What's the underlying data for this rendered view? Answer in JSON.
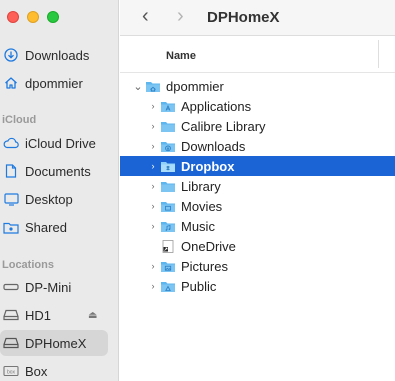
{
  "window": {
    "title": "DPHomeX"
  },
  "sidebar": {
    "favorites": [
      {
        "label": "Downloads",
        "icon": "download-circle-icon"
      },
      {
        "label": "dpommier",
        "icon": "home-icon"
      }
    ],
    "icloud_heading": "iCloud",
    "icloud": [
      {
        "label": "iCloud Drive",
        "icon": "cloud-icon"
      },
      {
        "label": "Documents",
        "icon": "document-icon"
      },
      {
        "label": "Desktop",
        "icon": "desktop-icon"
      },
      {
        "label": "Shared",
        "icon": "shared-folder-icon"
      }
    ],
    "locations_heading": "Locations",
    "locations": [
      {
        "label": "DP-Mini",
        "icon": "computer-icon"
      },
      {
        "label": "HD1",
        "icon": "drive-icon",
        "eject": "⏏"
      },
      {
        "label": "DPHomeX",
        "icon": "drive-icon",
        "selected": true
      },
      {
        "label": "Box",
        "icon": "box-icon"
      }
    ]
  },
  "columns": {
    "name": "Name"
  },
  "tree": {
    "root": {
      "label": "dpommier",
      "disclosure": "⌄"
    },
    "items": [
      {
        "label": "Applications",
        "disclosure": "›"
      },
      {
        "label": "Calibre Library",
        "disclosure": "›"
      },
      {
        "label": "Downloads",
        "disclosure": "›"
      },
      {
        "label": "Dropbox",
        "disclosure": "›",
        "selected": true
      },
      {
        "label": "Library",
        "disclosure": "›"
      },
      {
        "label": "Movies",
        "disclosure": "›"
      },
      {
        "label": "Music",
        "disclosure": "›"
      },
      {
        "label": "OneDrive",
        "disclosure": ""
      },
      {
        "label": "Pictures",
        "disclosure": "›"
      },
      {
        "label": "Public",
        "disclosure": "›"
      }
    ]
  },
  "colors": {
    "selection": "#1a64d6",
    "folder": "#5eb6ee",
    "sidebar_icon": "#1f7ae0"
  }
}
